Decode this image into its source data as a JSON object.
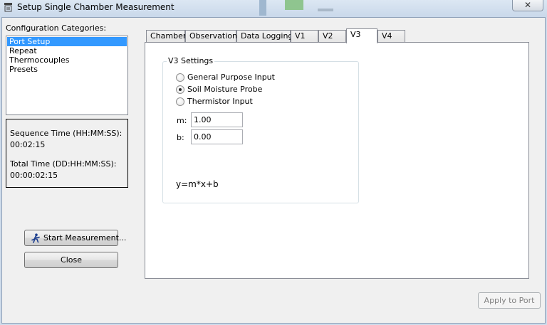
{
  "window": {
    "title": "Setup Single Chamber Measurement",
    "close_glyph": "✕"
  },
  "categories": {
    "label": "Configuration Categories:",
    "items": [
      "Port Setup",
      "Repeat",
      "Thermocouples",
      "Presets"
    ],
    "selected": "Port Setup"
  },
  "timing": {
    "sequence_label": "Sequence Time (HH:MM:SS):",
    "sequence_value": "00:02:15",
    "total_label": "Total Time (DD:HH:MM:SS):",
    "total_value": "00:00:02:15"
  },
  "buttons": {
    "start": "Start Measurement...",
    "close": "Close",
    "apply": "Apply to Port"
  },
  "tabs": [
    "Chamber",
    "Observation",
    "Data Logging",
    "V1",
    "V2",
    "V3",
    "V4"
  ],
  "active_tab": "V3",
  "v3": {
    "group_title": "V3 Settings",
    "options": [
      "General Purpose Input",
      "Soil Moisture Probe",
      "Thermistor Input"
    ],
    "selected_option": "Soil Moisture Probe",
    "m_label": "m:",
    "m_value": "1.00",
    "b_label": "b:",
    "b_value": "0.00",
    "formula": "y=m*x+b"
  },
  "colors": {
    "selection": "#3399ff",
    "window_bg": "#f0f0f0"
  },
  "icons": {
    "title": "window-app-icon",
    "start": "runner-icon"
  }
}
